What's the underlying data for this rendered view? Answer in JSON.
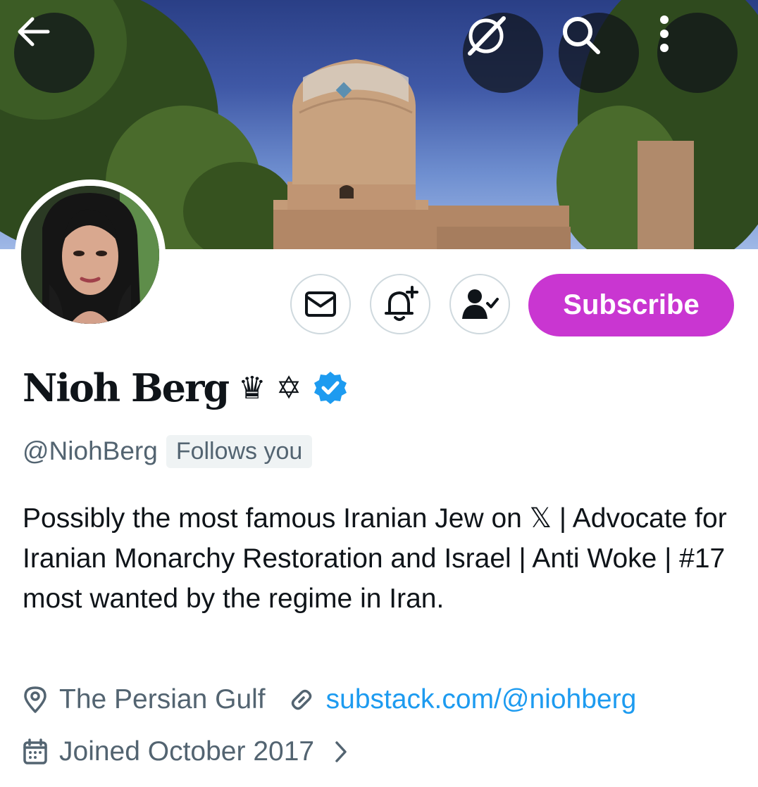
{
  "header": {
    "back_icon": "arrow-left-icon",
    "grok_icon": "grok-icon",
    "search_icon": "search-icon",
    "more_icon": "more-vertical-icon"
  },
  "actions": {
    "message_icon": "envelope-icon",
    "notify_icon": "bell-plus-icon",
    "following_icon": "person-check-icon",
    "subscribe_label": "Subscribe"
  },
  "profile": {
    "display_name": "Nioh Berg",
    "emojis": "♛ ✡",
    "verified": true,
    "handle": "@NiohBerg",
    "follows_you": "Follows you",
    "bio": "Possibly the most famous Iranian Jew on 𝕏 | Advocate for Iranian Monarchy Restoration and Israel | Anti Woke | #17 most wanted by the regime in Iran.",
    "location": "The Persian Gulf",
    "website": "substack.com/@niohberg",
    "joined": "Joined October 2017"
  },
  "colors": {
    "subscribe_bg": "#c936d1",
    "verified_blue": "#1d9bf0",
    "link_blue": "#1d9bf0",
    "secondary_text": "#536471"
  }
}
